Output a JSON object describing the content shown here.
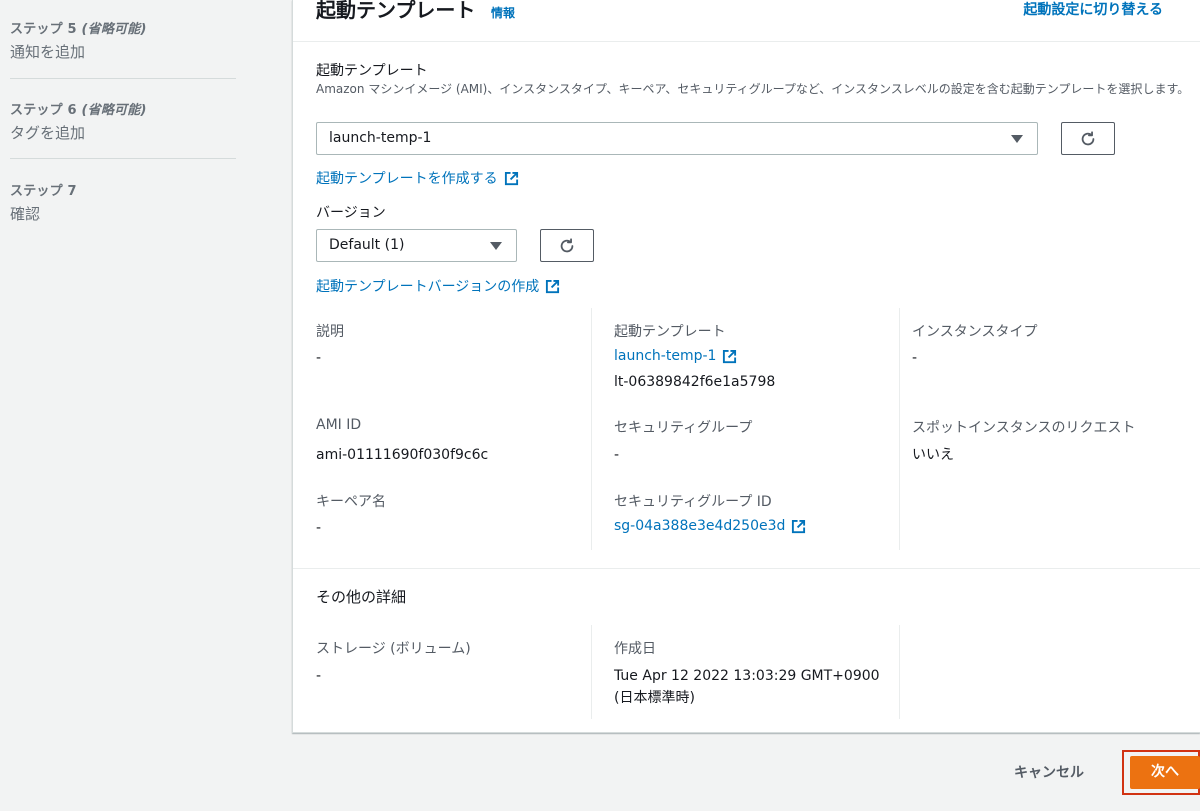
{
  "sidebar": {
    "steps": [
      {
        "label": "ステップ 5",
        "optional": "(省略可能)",
        "title": "通知を追加"
      },
      {
        "label": "ステップ 6",
        "optional": "(省略可能)",
        "title": "タグを追加"
      },
      {
        "label": "ステップ 7",
        "optional": "",
        "title": "確認"
      }
    ]
  },
  "panel": {
    "title": "起動テンプレート",
    "info_link": "情報",
    "switch_link": "起動設定に切り替える",
    "template_field": {
      "label": "起動テンプレート",
      "description": "Amazon マシンイメージ (AMI)、インスタンスタイプ、キーペア、セキュリティグループなど、インスタンスレベルの設定を含む起動テンプレートを選択します。",
      "selected": "launch-temp-1",
      "create_link": "起動テンプレートを作成する"
    },
    "version_field": {
      "label": "バージョン",
      "selected": "Default (1)",
      "create_link": "起動テンプレートバージョンの作成"
    },
    "details": {
      "description_key": "説明",
      "description_value": "-",
      "template_key": "起動テンプレート",
      "template_link": "launch-temp-1",
      "template_id": "lt-06389842f6e1a5798",
      "instance_type_key": "インスタンスタイプ",
      "instance_type_value": "-",
      "ami_key": "AMI ID",
      "ami_value": "ami-01111690f030f9c6c",
      "security_group_key": "セキュリティグループ",
      "security_group_value": "-",
      "spot_key": "スポットインスタンスのリクエスト",
      "spot_value": "いいえ",
      "keypair_key": "キーペア名",
      "keypair_value": "-",
      "sg_id_key": "セキュリティグループ ID",
      "sg_id_link": "sg-04a388e3e4d250e3d"
    },
    "other_details": {
      "title": "その他の詳細",
      "storage_key": "ストレージ (ボリューム)",
      "storage_value": "-",
      "created_key": "作成日",
      "created_value_line1": "Tue Apr 12 2022 13:03:29 GMT+0900",
      "created_value_line2": "(日本標準時)"
    }
  },
  "footer": {
    "cancel_label": "キャンセル",
    "next_label": "次へ"
  },
  "colors": {
    "link": "#0073bb",
    "primary_button": "#ec7211",
    "highlight_outline": "#d13212",
    "background": "#f2f3f3"
  }
}
